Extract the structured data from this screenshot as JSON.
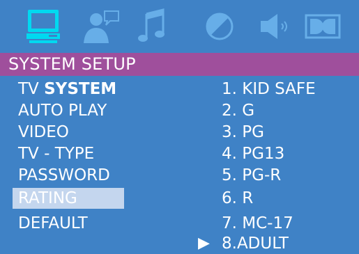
{
  "title": "SYSTEM SETUP",
  "icons": [
    "system-icon",
    "language-icon",
    "audio-icon",
    "video-icon",
    "speaker-icon",
    "dolby-icon"
  ],
  "colors": {
    "background": "#3f82c6",
    "title_bar": "#9f4f9c",
    "selected_item": "#c4d6ee",
    "active_icon": "#00d9f0",
    "inactive_icon": "#67aee8"
  },
  "menu": {
    "items": [
      {
        "prefix": "TV ",
        "bold": "SYSTEM"
      },
      {
        "label": "AUTO PLAY"
      },
      {
        "label": "VIDEO"
      },
      {
        "label": "TV - TYPE"
      },
      {
        "label": "PASSWORD"
      },
      {
        "label": "RATING"
      },
      {
        "label": "DEFAULT"
      }
    ],
    "selected": "RATING"
  },
  "options": {
    "items": [
      "1. KID SAFE",
      "2. G",
      "3. PG",
      "4. PG13",
      "5. PG-R",
      "6. R",
      "7. MC-17",
      "8.ADULT"
    ],
    "arrow": "▶",
    "current": "8.ADULT"
  }
}
